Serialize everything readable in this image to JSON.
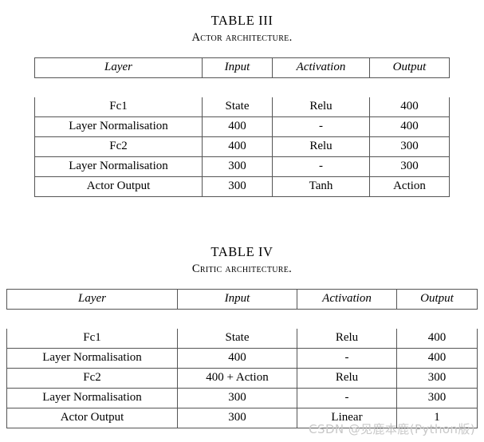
{
  "page": {
    "background": "#ffffff",
    "text_color": "#000000",
    "rule_color": "#555555"
  },
  "tables": [
    {
      "number": "TABLE III",
      "title": "Actor architecture.",
      "columns": [
        "Layer",
        "Input",
        "Activation",
        "Output"
      ],
      "rows": [
        [
          "Fc1",
          "State",
          "Relu",
          "400"
        ],
        [
          "Layer Normalisation",
          "400",
          "-",
          "400"
        ],
        [
          "Fc2",
          "400",
          "Relu",
          "300"
        ],
        [
          "Layer Normalisation",
          "300",
          "-",
          "300"
        ],
        [
          "Actor Output",
          "300",
          "Tanh",
          "Action"
        ]
      ]
    },
    {
      "number": "TABLE IV",
      "title": "Critic architecture.",
      "columns": [
        "Layer",
        "Input",
        "Activation",
        "Output"
      ],
      "rows": [
        [
          "Fc1",
          "State",
          "Relu",
          "400"
        ],
        [
          "Layer Normalisation",
          "400",
          "-",
          "400"
        ],
        [
          "Fc2",
          "400 + Action",
          "Relu",
          "300"
        ],
        [
          "Layer Normalisation",
          "300",
          "-",
          "300"
        ],
        [
          "Actor Output",
          "300",
          "Linear",
          "1"
        ]
      ]
    }
  ],
  "watermark": {
    "text": "CSDN @见鹿本鹿(Python版)",
    "color": "#c8c8c8"
  }
}
